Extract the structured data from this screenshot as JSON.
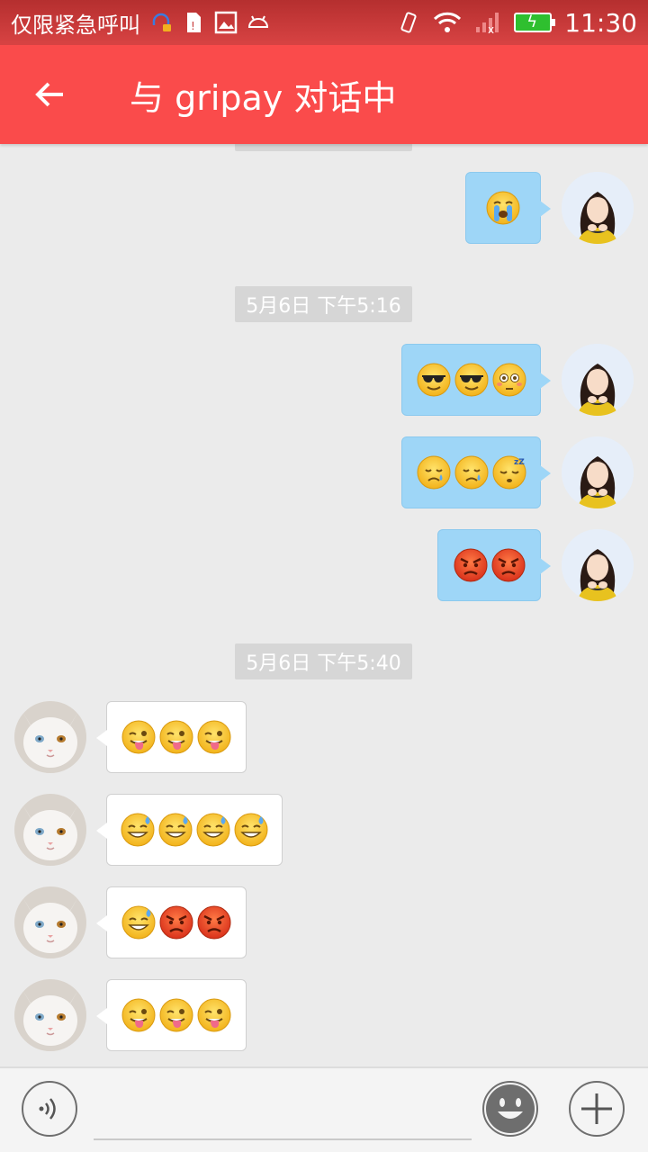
{
  "status_bar": {
    "carrier": "仅限紧急呼叫",
    "time": "11:30",
    "icons": [
      "headset-icon",
      "sim-alert-icon",
      "image-icon",
      "android-icon",
      "vibrate-icon",
      "wifi-icon",
      "signal-no-icon",
      "battery-charging-icon"
    ]
  },
  "toolbar": {
    "title": "与 gripay 对话中",
    "back_icon": "arrow-left-icon"
  },
  "chat": {
    "timestamps": [
      "5月6日 下午5:16",
      "5月6日 下午5:40"
    ],
    "messages": [
      {
        "side": "out",
        "emojis": [
          "loudly-crying"
        ]
      },
      {
        "side": "out",
        "emojis": [
          "sunglasses",
          "sunglasses",
          "flushed"
        ]
      },
      {
        "side": "out",
        "emojis": [
          "crying",
          "crying",
          "sleeping"
        ]
      },
      {
        "side": "out",
        "emojis": [
          "angry",
          "angry"
        ]
      },
      {
        "side": "in",
        "emojis": [
          "tongue-wink",
          "tongue-wink",
          "tongue-wink"
        ]
      },
      {
        "side": "in",
        "emojis": [
          "sweat-smile",
          "sweat-smile",
          "sweat-smile",
          "sweat-smile"
        ]
      },
      {
        "side": "in",
        "emojis": [
          "sweat-smile",
          "angry",
          "angry"
        ]
      },
      {
        "side": "in",
        "emojis": [
          "tongue-wink",
          "tongue-wink",
          "tongue-wink"
        ]
      }
    ]
  },
  "input_bar": {
    "placeholder": "",
    "icons": [
      "voice-icon",
      "emoji-icon",
      "plus-icon"
    ]
  },
  "colors": {
    "toolbar": "#fa4b4b",
    "bubble_out": "#9ed6f7",
    "bubble_in": "#ffffff",
    "background": "#ebebeb"
  }
}
